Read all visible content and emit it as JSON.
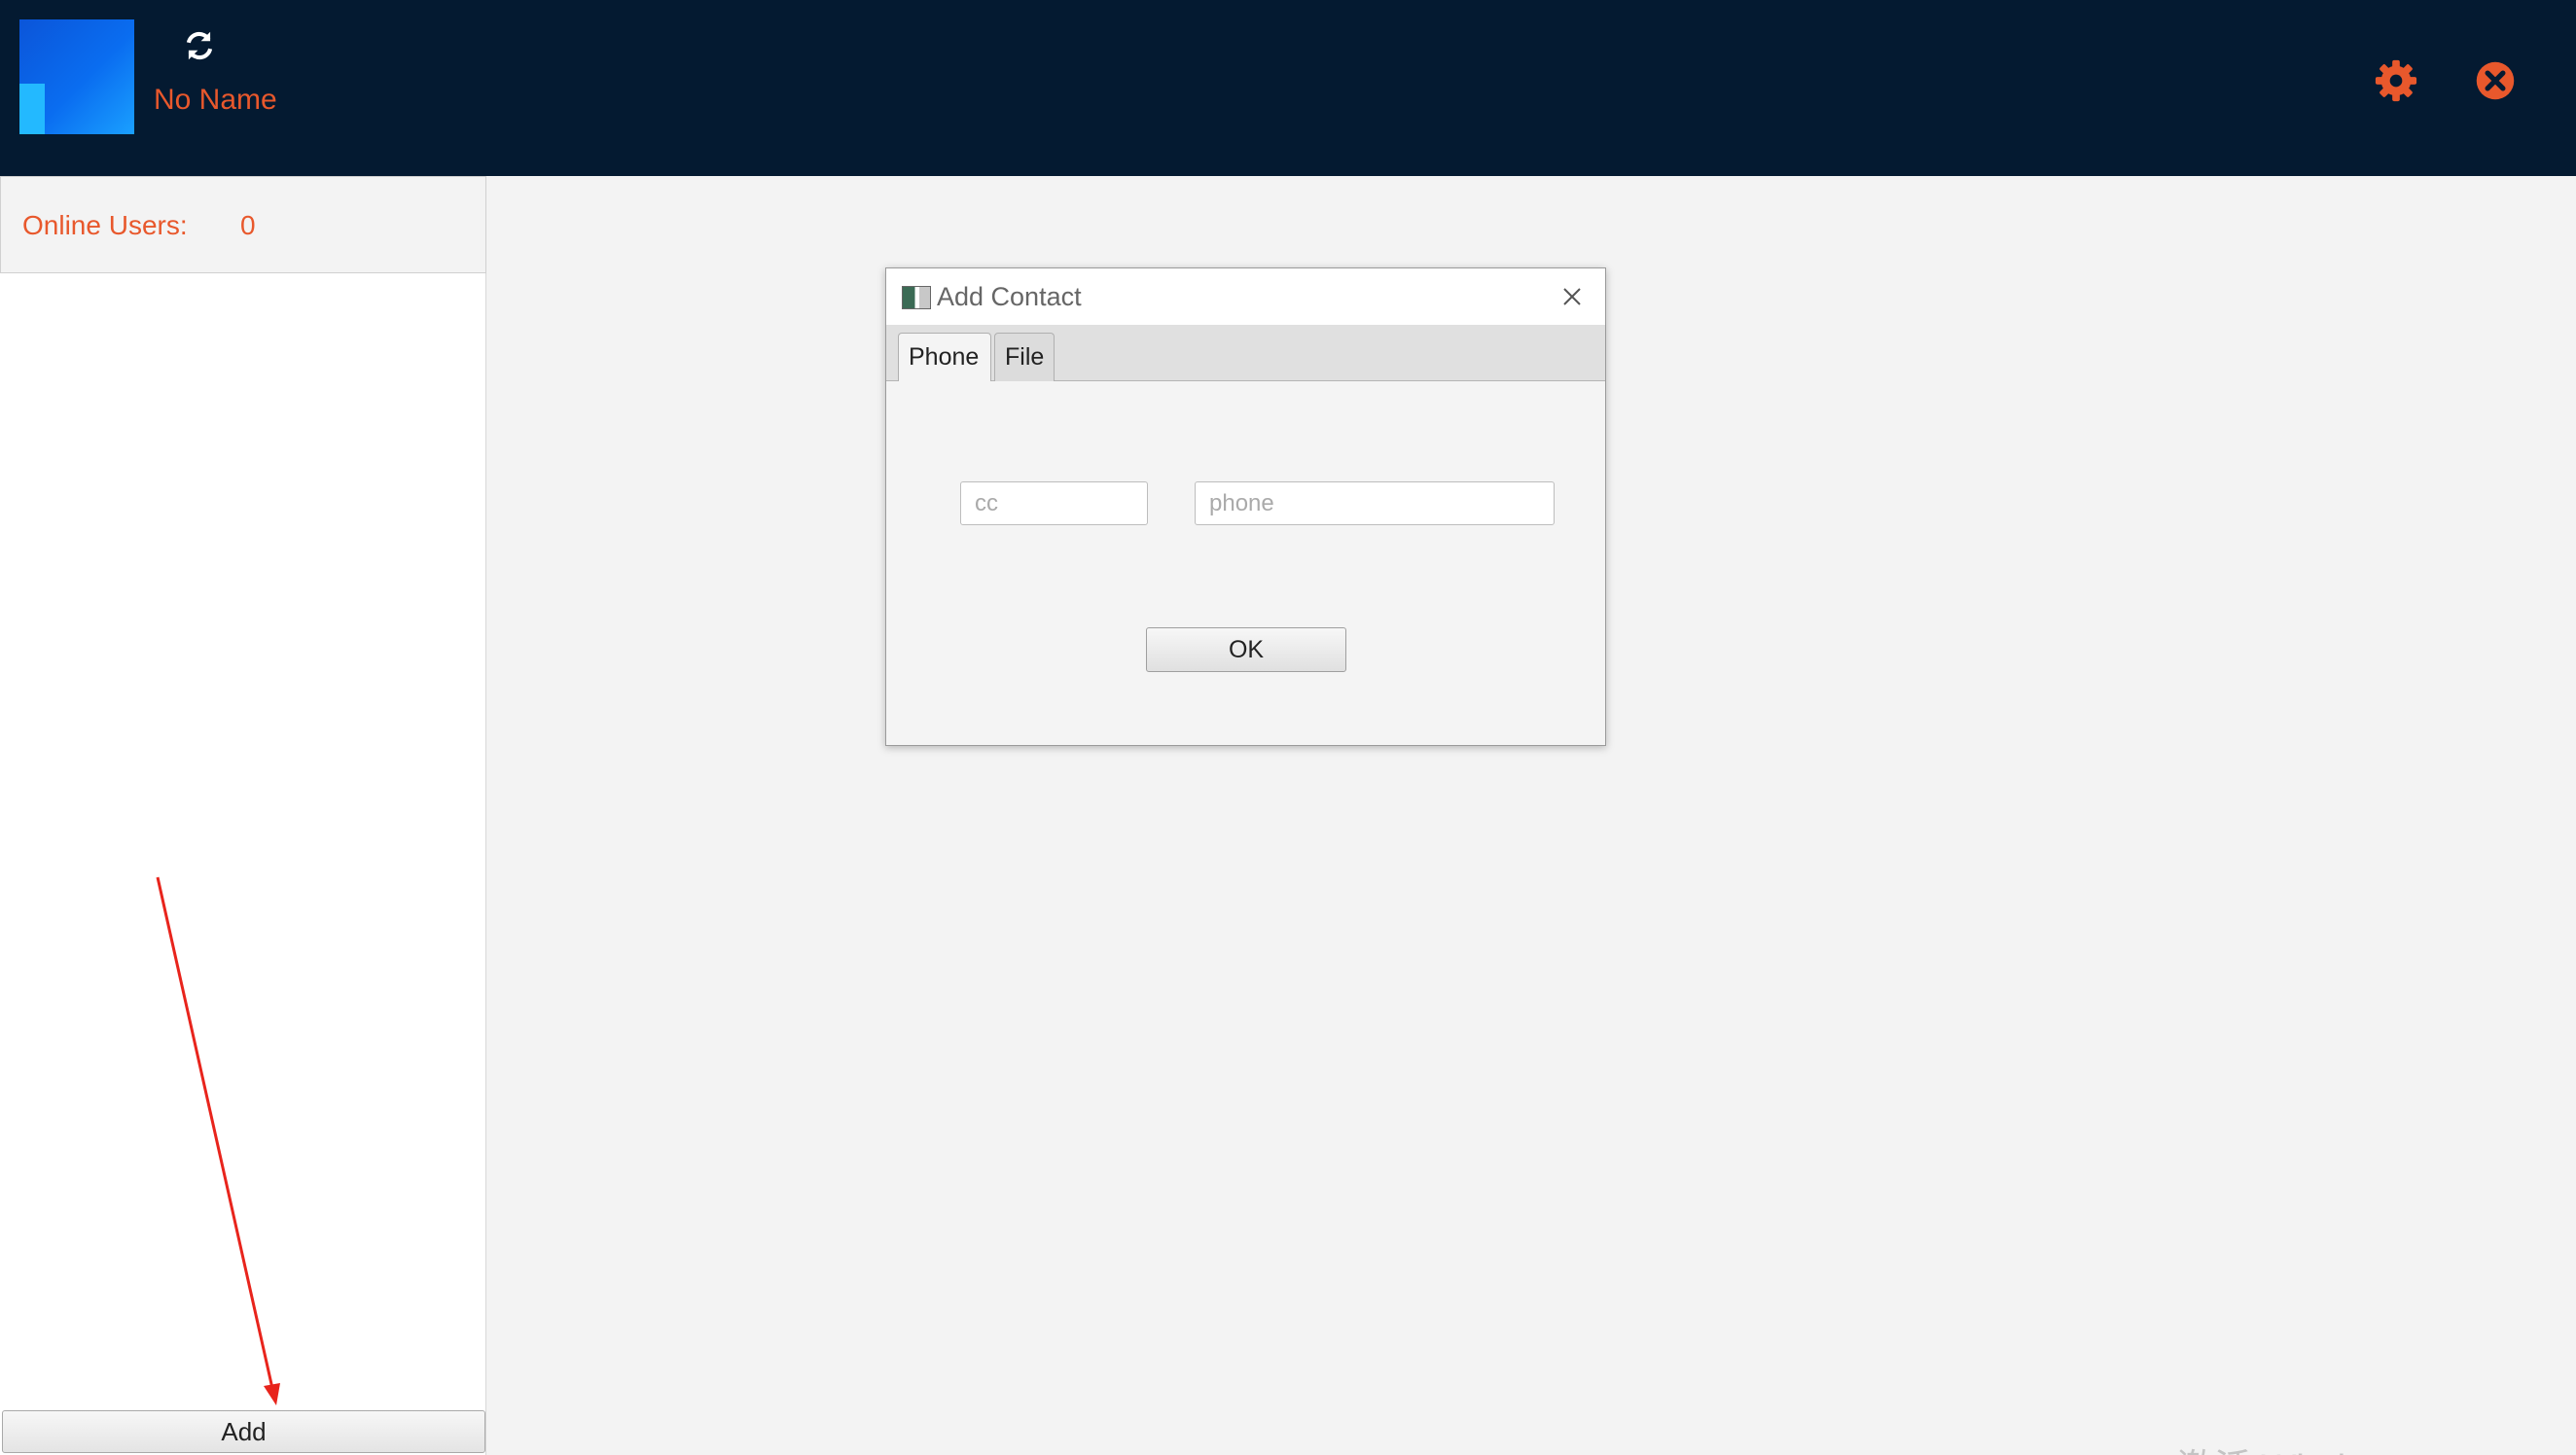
{
  "header": {
    "username": "No Name",
    "avatar_icon": "avatar-image",
    "refresh_icon": "refresh-icon",
    "settings_icon": "gear-icon",
    "close_icon": "close-circle-icon",
    "accent_color": "#e8582c",
    "background_color": "#041a31"
  },
  "sidebar": {
    "online_label": "Online Users:",
    "online_count": "0",
    "add_button": "Add"
  },
  "dialog": {
    "title": "Add Contact",
    "tabs": [
      {
        "label": "Phone",
        "selected": true
      },
      {
        "label": "File",
        "selected": false
      }
    ],
    "cc_placeholder": "cc",
    "cc_value": "",
    "phone_placeholder": "phone",
    "phone_value": "",
    "ok_button": "OK"
  },
  "annotation": {
    "arrow_color": "#e8241c",
    "points_to": "add-button"
  },
  "watermark": "激活 Windows"
}
